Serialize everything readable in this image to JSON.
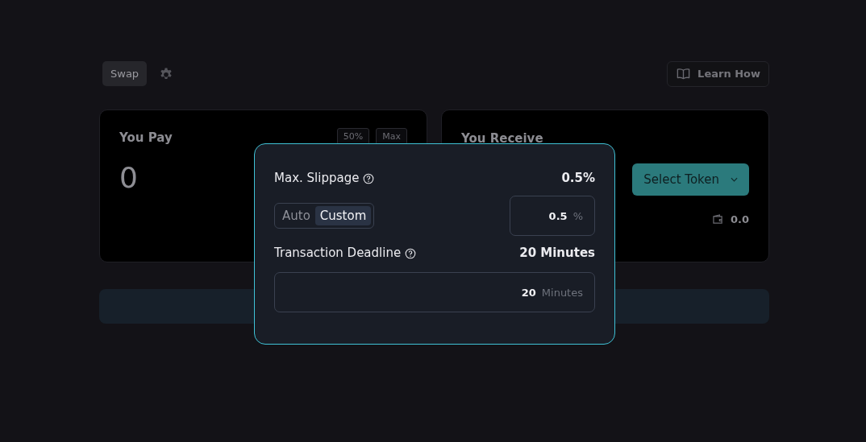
{
  "header": {
    "tab": "Swap",
    "learn_how": "Learn How"
  },
  "pay": {
    "title": "You Pay",
    "quick_buttons": [
      "50%",
      "Max"
    ],
    "amount": "0"
  },
  "receive": {
    "title": "You Receive",
    "select_token": "Select Token",
    "balance": "0.0"
  },
  "settings": {
    "slippage_label": "Max. Slippage",
    "slippage_value": "0.5%",
    "modes": [
      {
        "label": "Auto",
        "selected": false
      },
      {
        "label": "Custom",
        "selected": true
      }
    ],
    "slippage_input": "0.5",
    "slippage_unit": "%",
    "deadline_label": "Transaction Deadline",
    "deadline_value": "20 Minutes",
    "deadline_input": "20",
    "deadline_unit": "Minutes"
  }
}
